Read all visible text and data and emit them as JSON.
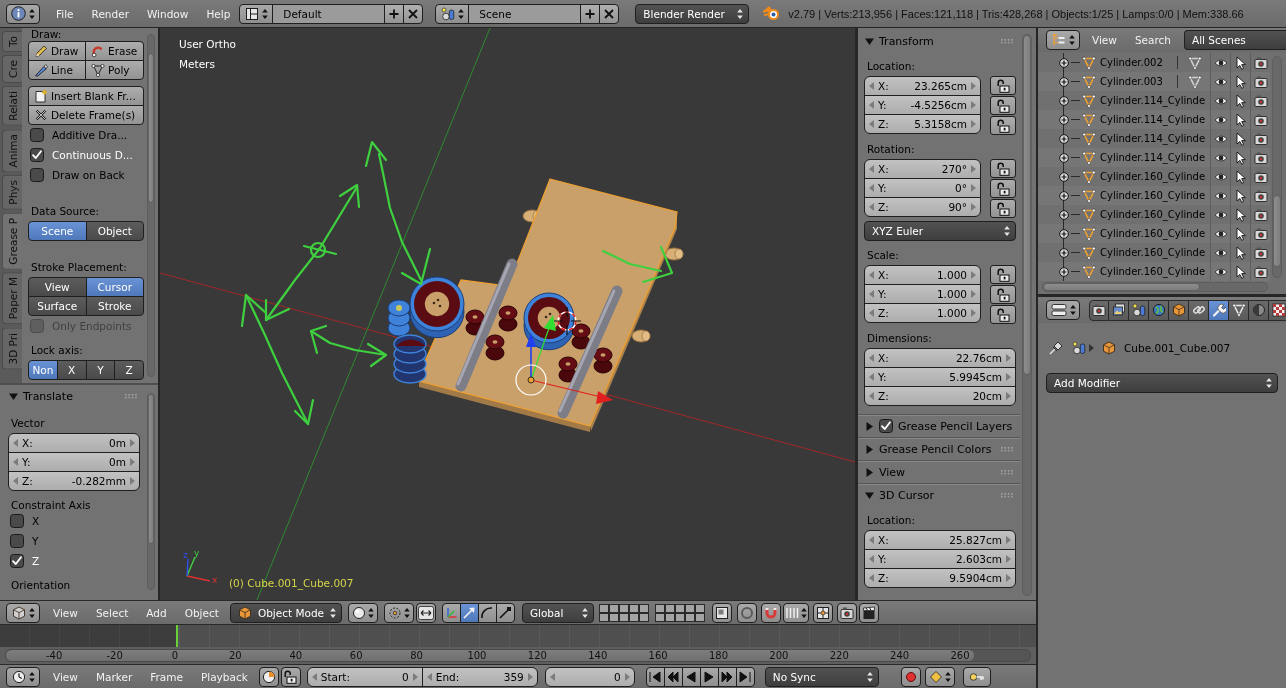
{
  "top_bar": {
    "menus": [
      "File",
      "Render",
      "Window",
      "Help"
    ],
    "layout": "Default",
    "scene": "Scene",
    "render_engine": "Blender Render",
    "stats": "v2.79 | Verts:213,956 | Faces:121,118 | Tris:428,268 | Objects:1/25 | Lamps:0/0 | Mem:338.66"
  },
  "tool_shelf": {
    "tabs": [
      {
        "label": "To",
        "selected": false
      },
      {
        "label": "Cre",
        "selected": false
      },
      {
        "label": "Relati",
        "selected": false
      },
      {
        "label": "Anima",
        "selected": false
      },
      {
        "label": "Phys",
        "selected": false
      },
      {
        "label": "Grease P",
        "selected": true
      },
      {
        "label": "Paper M",
        "selected": false
      },
      {
        "label": "3D Pri",
        "selected": false
      }
    ],
    "items": [
      {
        "kind": "label",
        "text": "Draw:"
      },
      {
        "kind": "tool_grid",
        "buttons": [
          {
            "label": "Draw",
            "kind": "draw"
          },
          {
            "label": "Erase",
            "kind": "erase"
          },
          {
            "label": "Line",
            "kind": "line"
          },
          {
            "label": "Poly",
            "kind": "poly"
          }
        ]
      },
      {
        "kind": "button_column",
        "buttons": [
          {
            "label": "Insert Blank Fr...",
            "kind": "insert"
          },
          {
            "label": "Delete Frame(s)",
            "kind": "delete"
          }
        ]
      },
      {
        "kind": "checkbox",
        "label": "Additive Dra...",
        "checked": false,
        "disabled": false
      },
      {
        "kind": "checkbox",
        "label": "Continuous D...",
        "checked": true,
        "disabled": false
      },
      {
        "kind": "checkbox",
        "label": "Draw on Back",
        "checked": false,
        "disabled": false
      },
      {
        "kind": "heading",
        "text": "Data Source:"
      },
      {
        "kind": "segmented",
        "rows": [
          [
            {
              "label": "Scene",
              "selected": true
            },
            {
              "label": "Object",
              "selected": false
            }
          ]
        ]
      },
      {
        "kind": "heading",
        "text": "Stroke Placement:"
      },
      {
        "kind": "segmented",
        "rows": [
          [
            {
              "label": "View",
              "selected": false
            },
            {
              "label": "Cursor",
              "selected": true
            }
          ],
          [
            {
              "label": "Surface",
              "selected": false
            },
            {
              "label": "Stroke",
              "selected": false
            }
          ]
        ]
      },
      {
        "kind": "checkbox",
        "label": "Only Endpoints",
        "checked": false,
        "disabled": true
      },
      {
        "kind": "label",
        "text": "Lock axis:"
      },
      {
        "kind": "segmented",
        "rows": [
          [
            {
              "label": "Non",
              "selected": true
            },
            {
              "label": "X",
              "selected": false
            },
            {
              "label": "Y",
              "selected": false
            },
            {
              "label": "Z",
              "selected": false
            }
          ]
        ]
      }
    ]
  },
  "operator_panel": {
    "title": "Translate",
    "expanded": true,
    "items": [
      {
        "kind": "label",
        "text": "Vector"
      },
      {
        "kind": "vector",
        "fields": [
          {
            "axis": "X:",
            "value": "0m"
          },
          {
            "axis": "Y:",
            "value": "0m"
          },
          {
            "axis": "Z:",
            "value": "-0.282mm"
          }
        ]
      },
      {
        "kind": "label",
        "text": "Constraint Axis"
      },
      {
        "kind": "checkbox",
        "label": "X",
        "checked": false,
        "disabled": false
      },
      {
        "kind": "checkbox",
        "label": "Y",
        "checked": false,
        "disabled": false
      },
      {
        "kind": "checkbox",
        "label": "Z",
        "checked": true,
        "disabled": false
      },
      {
        "kind": "label",
        "text": "Orientation"
      }
    ]
  },
  "viewport": {
    "view_name": "User Ortho",
    "units": "Meters",
    "object_info": "(0) Cube.001_Cube.007",
    "axis_labels": [
      "x",
      "y",
      "z"
    ]
  },
  "n_panel": {
    "panels": [
      {
        "title": "Transform",
        "expanded": true,
        "items": [
          {
            "kind": "label",
            "text": "Location:"
          },
          {
            "kind": "vector",
            "fields": [
              {
                "axis": "X:",
                "value": "23.265cm",
                "locked": false
              },
              {
                "axis": "Y:",
                "value": "-4.5256cm",
                "locked": false
              },
              {
                "axis": "Z:",
                "value": "5.3158cm",
                "locked": false
              }
            ]
          },
          {
            "kind": "label",
            "text": "Rotation:"
          },
          {
            "kind": "vector",
            "fields": [
              {
                "axis": "X:",
                "value": "270°",
                "locked": false
              },
              {
                "axis": "Y:",
                "value": "0°",
                "locked": false
              },
              {
                "axis": "Z:",
                "value": "90°",
                "locked": false
              }
            ]
          },
          {
            "kind": "dropdown",
            "value": "XYZ Euler"
          },
          {
            "kind": "label",
            "text": "Scale:"
          },
          {
            "kind": "vector",
            "fields": [
              {
                "axis": "X:",
                "value": "1.000",
                "locked": false
              },
              {
                "axis": "Y:",
                "value": "1.000",
                "locked": false
              },
              {
                "axis": "Z:",
                "value": "1.000",
                "locked": false
              }
            ]
          },
          {
            "kind": "label",
            "text": "Dimensions:"
          },
          {
            "kind": "vector",
            "fields": [
              {
                "axis": "X:",
                "value": "22.76cm"
              },
              {
                "axis": "Y:",
                "value": "5.9945cm"
              },
              {
                "axis": "Z:",
                "value": "20cm"
              }
            ]
          }
        ]
      },
      {
        "title": "Grease Pencil Layers",
        "expanded": false,
        "checked": true
      },
      {
        "title": "Grease Pencil Colors",
        "expanded": false
      },
      {
        "title": "View",
        "expanded": false
      },
      {
        "title": "3D Cursor",
        "expanded": true,
        "items": [
          {
            "kind": "label",
            "text": "Location:"
          },
          {
            "kind": "vector",
            "fields": [
              {
                "axis": "X:",
                "value": "25.827cm"
              },
              {
                "axis": "Y:",
                "value": "2.603cm"
              },
              {
                "axis": "Z:",
                "value": "9.5904cm"
              }
            ]
          }
        ]
      }
    ]
  },
  "outliner": {
    "menus": [
      "View",
      "Search"
    ],
    "filter": "All Scenes",
    "rows": [
      {
        "name": "Cylinder.002",
        "data_icon": true
      },
      {
        "name": "Cylinder.003",
        "data_icon": true
      },
      {
        "name": "Cylinder.114_Cylinde",
        "data_icon": false
      },
      {
        "name": "Cylinder.114_Cylinde",
        "data_icon": false
      },
      {
        "name": "Cylinder.114_Cylinde",
        "data_icon": false
      },
      {
        "name": "Cylinder.114_Cylinde",
        "data_icon": false
      },
      {
        "name": "Cylinder.160_Cylinde",
        "data_icon": false
      },
      {
        "name": "Cylinder.160_Cylinde",
        "data_icon": false
      },
      {
        "name": "Cylinder.160_Cylinde",
        "data_icon": false
      },
      {
        "name": "Cylinder.160_Cylinde",
        "data_icon": false
      },
      {
        "name": "Cylinder.160_Cylinde",
        "data_icon": false
      },
      {
        "name": "Cylinder.160_Cylinde",
        "data_icon": false
      }
    ]
  },
  "properties": {
    "context_tabs": [
      {
        "kind": "render",
        "selected": false
      },
      {
        "kind": "render_layers",
        "selected": false
      },
      {
        "kind": "scene",
        "selected": false
      },
      {
        "kind": "world",
        "selected": false
      },
      {
        "kind": "object",
        "selected": false
      },
      {
        "kind": "constraints",
        "selected": false
      },
      {
        "kind": "modifiers",
        "selected": true
      },
      {
        "kind": "data",
        "selected": false
      },
      {
        "kind": "material",
        "selected": false
      },
      {
        "kind": "texture",
        "selected": false
      }
    ],
    "breadcrumb": "Cube.001_Cube.007",
    "add_modifier": "Add Modifier"
  },
  "view3d_header": {
    "menus": [
      "View",
      "Select",
      "Add",
      "Object"
    ],
    "mode": "Object Mode",
    "manipulators": [
      {
        "kind": "axes",
        "selected": false
      },
      {
        "kind": "translate",
        "selected": true
      },
      {
        "kind": "rotate",
        "selected": false
      },
      {
        "kind": "scale",
        "selected": false
      }
    ],
    "orientation": "Global"
  },
  "timeline": {
    "ruler_labels": [
      "-40",
      "-20",
      "0",
      "20",
      "40",
      "60",
      "80",
      "100",
      "120",
      "140",
      "160",
      "180",
      "200",
      "220",
      "240",
      "260"
    ],
    "playhead": {
      "level": 0.17
    },
    "menus": [
      "View",
      "Marker",
      "Frame",
      "Playback"
    ],
    "start": {
      "label": "Start:",
      "value": "0"
    },
    "end": {
      "label": "End:",
      "value": "359"
    },
    "current_frame": "0",
    "sync": "No Sync"
  }
}
